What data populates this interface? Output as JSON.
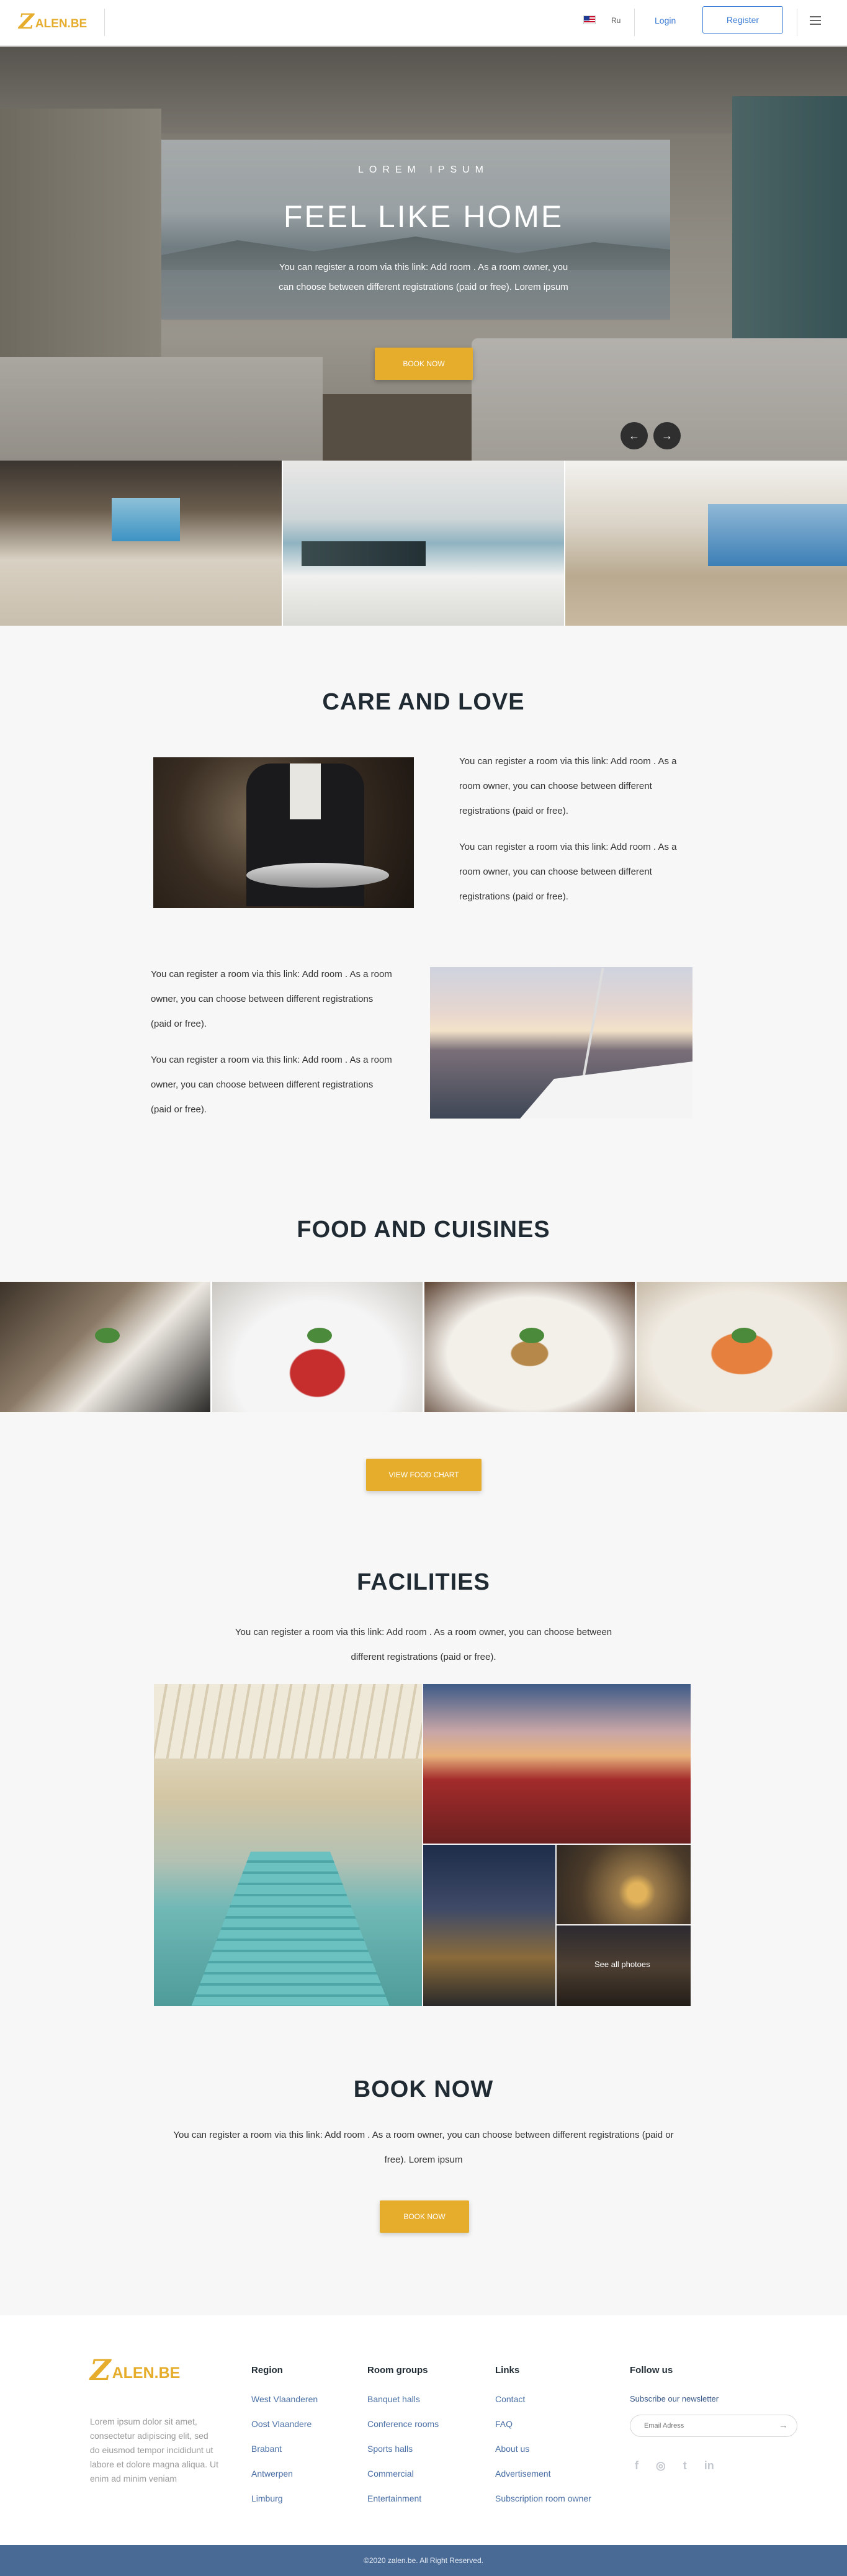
{
  "brand": {
    "logo_mark": "Z",
    "logo_text": "ALEN.BE"
  },
  "header": {
    "flag_icon": "us-flag-icon",
    "language": "Ru",
    "login": "Login",
    "register": "Register",
    "menu_icon": "hamburger-icon"
  },
  "hero": {
    "eyebrow": "LOREM IPSUM",
    "title": "FEEL LIKE HOME",
    "description": "You can register a room via this link: Add room . As a room owner, you can choose between different registrations (paid or free). Lorem ipsum",
    "button": "BOOK NOW",
    "prev_arrow": "←",
    "next_arrow": "→"
  },
  "care": {
    "title": "CARE AND LOVE",
    "para1": "You can register a room via this link: Add room . As a room owner, you can choose between different registrations (paid or free).",
    "para2": "You can register a room via this link: Add room . As a room owner, you can choose between different registrations (paid or free).",
    "para3": "You can register a room via this link: Add room . As a room owner, you can choose between different registrations (paid or free).",
    "para4": "You can register a room via this link: Add room . As a room owner, you can choose between different registrations (paid or free)."
  },
  "food": {
    "title": "FOOD AND CUISINES",
    "button": "VIEW FOOD CHART"
  },
  "facilities": {
    "title": "FACILITIES",
    "description": "You can register a room via this link: Add room . As a room owner, you can choose between different registrations (paid or free).",
    "see_all": "See all photoes"
  },
  "book": {
    "title": "BOOK NOW",
    "description": "You can register a room via this link: Add room . As a room owner, you can choose between different registrations (paid or free). Lorem ipsum",
    "button": "BOOK NOW"
  },
  "footer": {
    "about": "Lorem ipsum dolor sit amet, consectetur adipiscing elit, sed do eiusmod tempor incididunt ut labore et dolore magna aliqua. Ut enim ad minim veniam",
    "region": {
      "title": "Region",
      "items": [
        "West Vlaanderen",
        "Oost Vlaandere",
        "Brabant",
        "Antwerpen",
        "Limburg"
      ]
    },
    "room_groups": {
      "title": "Room groups",
      "items": [
        "Banquet halls",
        "Conference rooms",
        "Sports halls",
        "Commercial",
        "Entertainment"
      ]
    },
    "links": {
      "title": "Links",
      "items": [
        "Contact",
        "FAQ",
        "About us",
        "Advertisement",
        "Subscription room owner"
      ]
    },
    "follow": {
      "title": "Follow us",
      "subscribe": "Subscribe our newsletter",
      "email_placeholder": "Email Adress",
      "social": [
        "f",
        "◎",
        "t",
        "in"
      ]
    },
    "copyright": "©2020 zalen.be. All Right Reserved."
  }
}
